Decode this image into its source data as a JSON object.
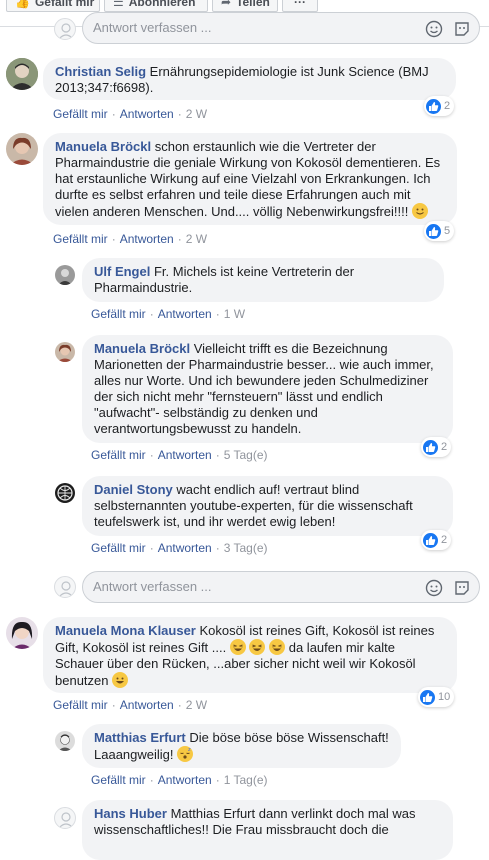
{
  "top_actions": {
    "like_label": "Gefällt mir",
    "subscribe_label": "Abonnieren",
    "share_label": "Teilen",
    "more_label": "···"
  },
  "reply_placeholder": "Antwort verfassen ...",
  "actions": {
    "like": "Gefällt mir",
    "reply": "Antworten",
    "separator": "·"
  },
  "comments": [
    {
      "name": "Christian Selig",
      "text": "Ernährungsepidemiologie ist Junk Science (BMJ 2013;347:f6698).",
      "time": "2 W",
      "likes": "2"
    },
    {
      "name": "Manuela Bröckl",
      "text": "schon erstaunlich wie die Vertreter der Pharmaindustrie die geniale Wirkung von Kokosöl dementieren. Es hat erstaunliche Wirkung auf eine Vielzahl von Erkrankungen. Ich durfte es selbst erfahren und teile diese Erfahrungen auch mit vielen anderen Menschen. Und.... völlig Nebenwirkungsfrei!!!!",
      "time": "2 W",
      "likes": "5",
      "replies": [
        {
          "name": "Ulf Engel",
          "text": "Fr. Michels ist keine Vertreterin der Pharmaindustrie.",
          "time": "1 W"
        },
        {
          "name": "Manuela Bröckl",
          "text": "Vielleicht trifft es die Bezeichnung Marionetten der Pharmaindustrie besser... wie auch immer, alles nur Worte. Und ich bewundere jeden Schulmediziner der sich nicht mehr \"fernsteuern\" lässt und endlich \"aufwacht\"- selbständig zu denken und verantwortungsbewusst zu handeln.",
          "time": "5 Tag(e)",
          "likes": "2"
        },
        {
          "name": "Daniel Stony",
          "text": "wacht endlich auf! vertraut blind selbsternannten youtube-experten, für die wissenschaft teufelswerk ist, und ihr werdet ewig leben!",
          "time": "3 Tag(e)",
          "likes": "2"
        }
      ]
    },
    {
      "name": "Manuela Mona Klauser",
      "text_a": "Kokosöl ist reines Gift, Kokosöl ist reines Gift, Kokosöl ist reines Gift ....",
      "text_b": "da laufen mir kalte Schauer über den Rücken, ...aber sicher nicht weil wir Kokosöl benutzen",
      "time": "2 W",
      "likes": "10",
      "replies": [
        {
          "name": "Matthias Erfurt",
          "text": "Die böse böse böse Wissenschaft! Laaangweilig!",
          "time": "1 Tag(e)"
        },
        {
          "name": "Hans Huber",
          "text": "Matthias Erfurt dann verlinkt doch mal was wissenschaftliches!! Die Frau missbraucht doch die"
        }
      ]
    }
  ],
  "colors": {
    "link": "#385898",
    "bubble": "#f2f3f5",
    "meta_grey": "#90949c",
    "like_blue": "#1877f2"
  }
}
